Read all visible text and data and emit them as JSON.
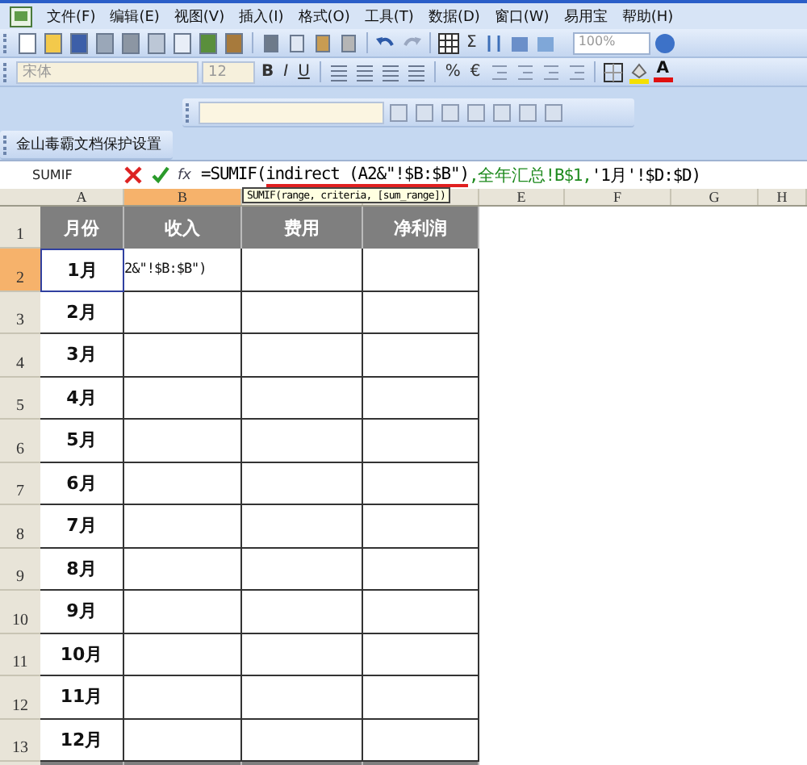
{
  "menu": [
    "文件(F)",
    "编辑(E)",
    "视图(V)",
    "插入(I)",
    "格式(O)",
    "工具(T)",
    "数据(D)",
    "窗口(W)",
    "易用宝",
    "帮助(H)"
  ],
  "standard_toolbar": {
    "zoom": "100%",
    "sigma": "Σ"
  },
  "format_toolbar": {
    "font": "宋体",
    "size": "12",
    "bold": "B",
    "italic": "I",
    "underline": "U",
    "percent": "%",
    "euro": "€",
    "font_color": "A"
  },
  "kingsoft_toolbar": {
    "label": "金山毒霸文档保护设置"
  },
  "formula_bar": {
    "name_box": "SUMIF",
    "fx": "fx",
    "segments": [
      {
        "text": "=SUMIF(",
        "kind": "plain"
      },
      {
        "text": "indirect (A2&\"!$B:$B\")",
        "kind": "marked"
      },
      {
        "text": ",全年汇总!B$1,",
        "kind": "reference"
      },
      {
        "text": "'1月'!$D:$D)",
        "kind": "plain"
      }
    ],
    "tooltip": "SUMIF(range, criteria, [sum_range])"
  },
  "columns": [
    {
      "label": "A",
      "selected": false
    },
    {
      "label": "B",
      "selected": true
    },
    {
      "selected": false
    },
    {
      "selected": false
    },
    {
      "label": "E",
      "selected": false
    },
    {
      "label": "F",
      "selected": false
    },
    {
      "label": "G",
      "selected": false
    },
    {
      "label": "H",
      "selected": false
    }
  ],
  "table_header": [
    "月份",
    "收入",
    "费用",
    "净利润"
  ],
  "rows": [
    {
      "number": "2",
      "selected": true,
      "month": "1月",
      "income": "2&\"!$B:$B\")"
    },
    {
      "number": "3",
      "selected": false,
      "month": "2月"
    },
    {
      "number": "4",
      "selected": false,
      "month": "3月"
    },
    {
      "number": "5",
      "selected": false,
      "month": "4月"
    },
    {
      "number": "6",
      "selected": false,
      "month": "5月"
    },
    {
      "number": "7",
      "selected": false,
      "month": "6月"
    },
    {
      "number": "8",
      "selected": false,
      "month": "7月"
    },
    {
      "number": "9",
      "selected": false,
      "month": "8月"
    },
    {
      "number": "10",
      "selected": false,
      "month": "9月"
    },
    {
      "number": "11",
      "selected": false,
      "month": "10月"
    },
    {
      "number": "12",
      "selected": false,
      "month": "11月"
    },
    {
      "number": "13",
      "selected": false,
      "month": "12月"
    }
  ],
  "header_row_number": "1"
}
